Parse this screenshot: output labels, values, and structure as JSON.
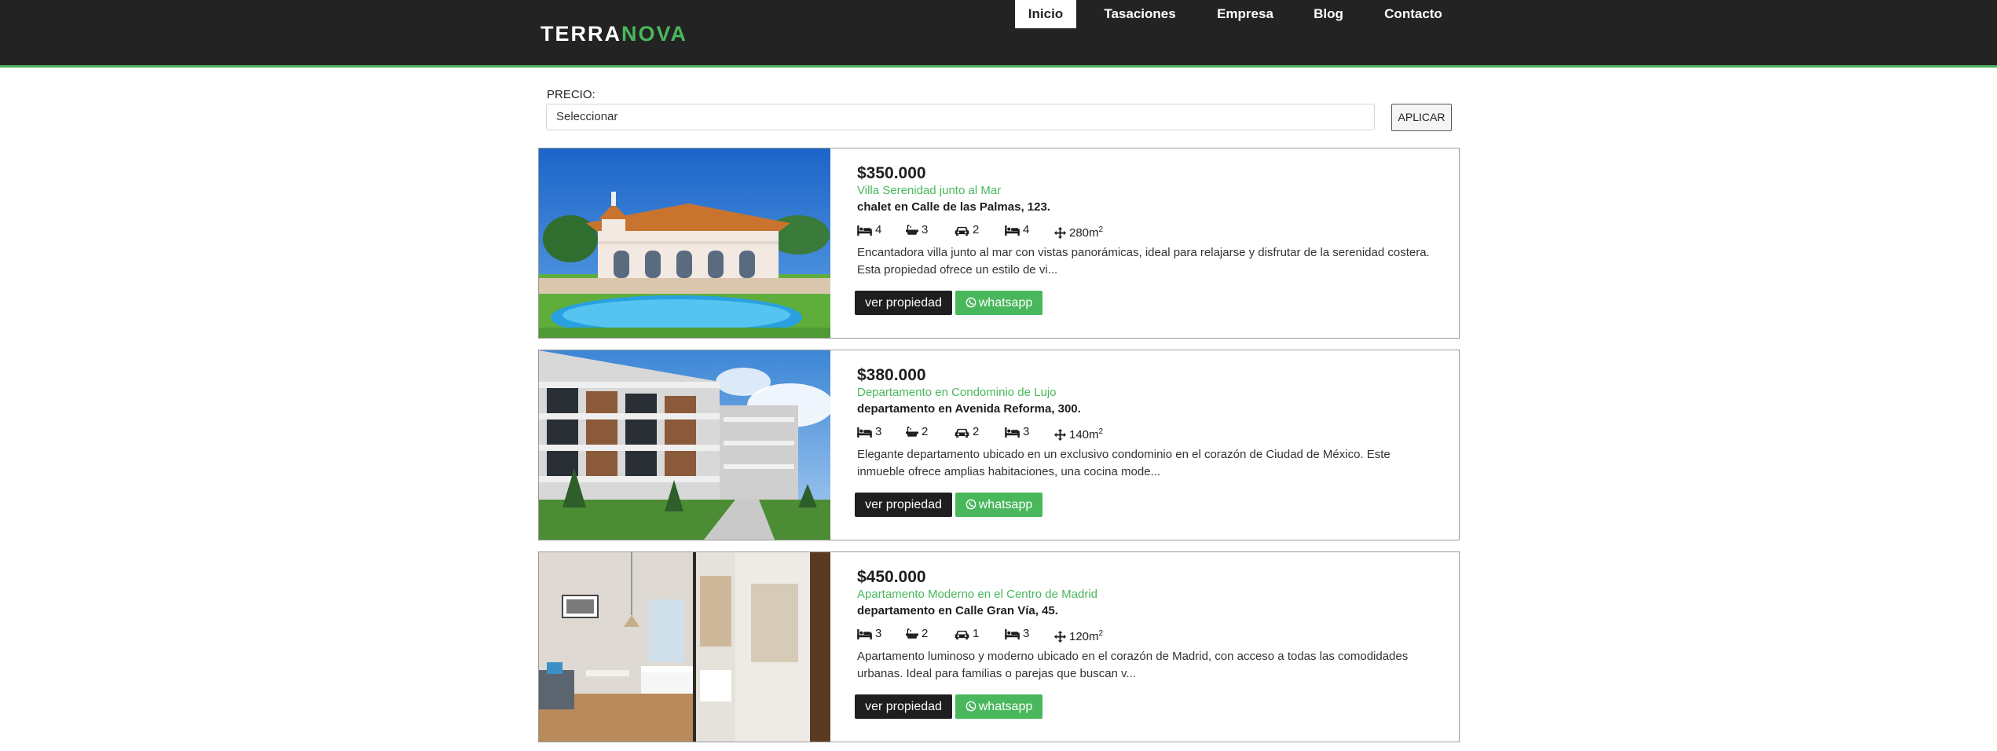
{
  "brand": {
    "part1": "TERRA",
    "part2": "NOVA"
  },
  "nav": [
    {
      "label": "Inicio",
      "active": true
    },
    {
      "label": "Tasaciones"
    },
    {
      "label": "Empresa"
    },
    {
      "label": "Blog"
    },
    {
      "label": "Contacto"
    }
  ],
  "filter": {
    "label": "PRECIO:",
    "value": "Seleccionar",
    "apply_label": "APLICAR"
  },
  "listings": [
    {
      "price": "$350.000",
      "title": "Villa Serenidad junto al Mar",
      "address": "chalet en Calle de las Palmas, 123.",
      "bedrooms": "4",
      "bathrooms": "3",
      "parking": "2",
      "rooms": "4",
      "area": "280m",
      "description": "Encantadora villa junto al mar con vistas panorámicas, ideal para relajarse y disfrutar de la serenidad costera. Esta propiedad ofrece un estilo de vi...",
      "view_label": "ver propiedad",
      "whatsapp_label": "whatsapp"
    },
    {
      "price": "$380.000",
      "title": "Departamento en Condominio de Lujo",
      "address": "departamento en Avenida Reforma, 300.",
      "bedrooms": "3",
      "bathrooms": "2",
      "parking": "2",
      "rooms": "3",
      "area": "140m",
      "description": "Elegante departamento ubicado en un exclusivo condominio en el corazón de Ciudad de México. Este inmueble ofrece amplias habitaciones, una cocina mode...",
      "view_label": "ver propiedad",
      "whatsapp_label": "whatsapp"
    },
    {
      "price": "$450.000",
      "title": "Apartamento Moderno en el Centro de Madrid",
      "address": "departamento en Calle Gran Vía, 45.",
      "bedrooms": "3",
      "bathrooms": "2",
      "parking": "1",
      "rooms": "3",
      "area": "120m",
      "description": "Apartamento luminoso y moderno ubicado en el corazón de Madrid, con acceso a todas las comodidades urbanas. Ideal para familias o parejas que buscan v...",
      "view_label": "ver propiedad",
      "whatsapp_label": "whatsapp"
    }
  ],
  "area_unit_sup": "2",
  "colors": {
    "accent": "#49b75c",
    "dark": "#232323"
  }
}
